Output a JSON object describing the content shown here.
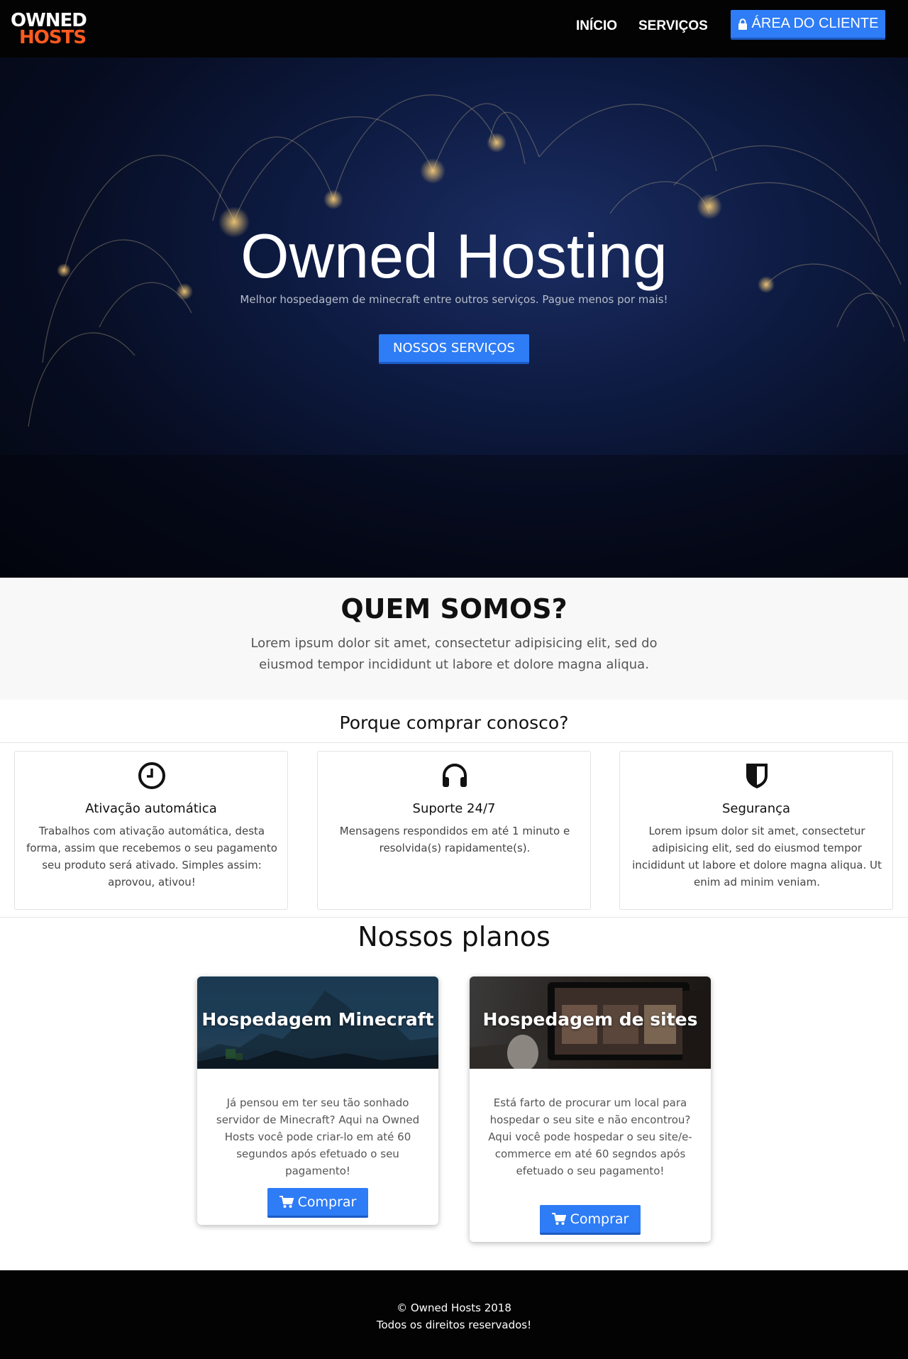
{
  "brand": {
    "logo_line1": "OWNED",
    "logo_line2": "HOSTS"
  },
  "nav": {
    "home": "INÍCIO",
    "services": "SERVIÇOS",
    "client_area": "ÁREA DO CLIENTE"
  },
  "hero": {
    "title": "Owned Hosting",
    "subtitle": "Melhor hospedagem de minecraft entre outros serviços. Pague menos por mais!",
    "button": "NOSSOS SERVIÇOS"
  },
  "about": {
    "title": "QUEM SOMOS?",
    "text": "Lorem ipsum dolor sit amet, consectetur adipisicing elit, sed do eiusmod tempor incididunt ut labore et dolore magna aliqua."
  },
  "why": {
    "title": "Porque comprar conosco?",
    "features": [
      {
        "icon": "clock-icon",
        "title": "Ativação automática",
        "text": "Trabalhos com ativação automática, desta forma, assim que recebemos o seu pagamento seu produto será ativado. Simples assim: aprovou, ativou!"
      },
      {
        "icon": "headphones-icon",
        "title": "Suporte 24/7",
        "text": "Mensagens respondidos em até 1 minuto e resolvida(s) rapidamente(s)."
      },
      {
        "icon": "shield-icon",
        "title": "Segurança",
        "text": "Lorem ipsum dolor sit amet, consectetur adipisicing elit, sed do eiusmod tempor incididunt ut labore et dolore magna aliqua. Ut enim ad minim veniam."
      }
    ]
  },
  "plans": {
    "title": "Nossos planos",
    "items": [
      {
        "title": "Hospedagem Minecraft",
        "text": "Já pensou em ter seu tão sonhado servidor de Minecraft? Aqui na Owned Hosts você pode criar-lo em até 60 segundos após efetuado o seu pagamento!",
        "button": "Comprar"
      },
      {
        "title": "Hospedagem de sites",
        "text": "Está farto de procurar um local para hospedar o seu site e não encontrou? Aqui você pode hospedar o seu site/e-commerce em até 60 segndos após efetuado o seu pagamento!",
        "button": "Comprar"
      }
    ]
  },
  "footer": {
    "copyright": "© Owned Hosts 2018",
    "rights": "Todos os direitos reservados!"
  },
  "colors": {
    "accent": "#2e7cf6",
    "logo_orange": "#ff5a1f",
    "navbar": "#030303",
    "footer": "#030303"
  }
}
